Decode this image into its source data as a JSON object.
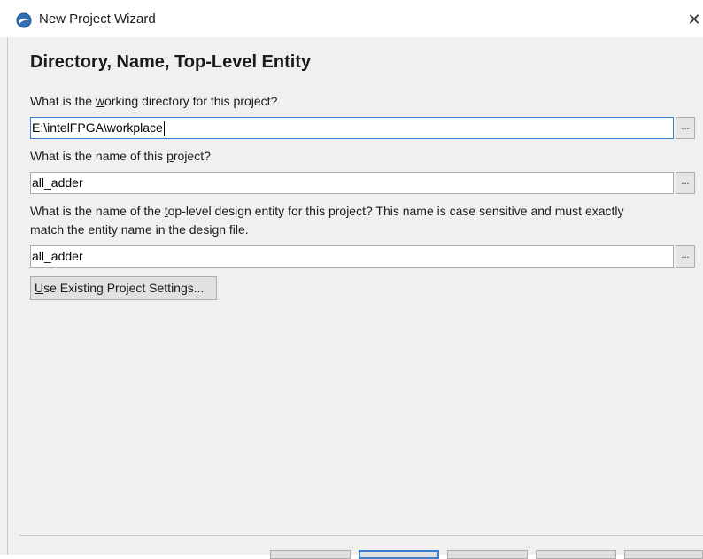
{
  "window": {
    "title": "New Project Wizard",
    "close_glyph": "✕"
  },
  "page": {
    "heading": "Directory, Name, Top-Level Entity"
  },
  "form": {
    "working_dir": {
      "label_pre": "What is the ",
      "label_mnemonic": "w",
      "label_post": "orking directory for this project?",
      "value": "E:\\intelFPGA\\workplace",
      "browse_label": "..."
    },
    "project_name": {
      "label_pre": "What is the name of this ",
      "label_mnemonic": "p",
      "label_post": "roject?",
      "value": "all_adder",
      "browse_label": "..."
    },
    "top_entity": {
      "label_pre": "What is the name of the ",
      "label_mnemonic": "t",
      "label_post": "op-level design entity for this project? This name is case sensitive and must exactly",
      "label_line2": "match the entity name in the design file.",
      "value": "all_adder",
      "browse_label": "..."
    },
    "use_existing": {
      "label_mnemonic": "U",
      "label_post": "se Existing Project Settings..."
    }
  }
}
